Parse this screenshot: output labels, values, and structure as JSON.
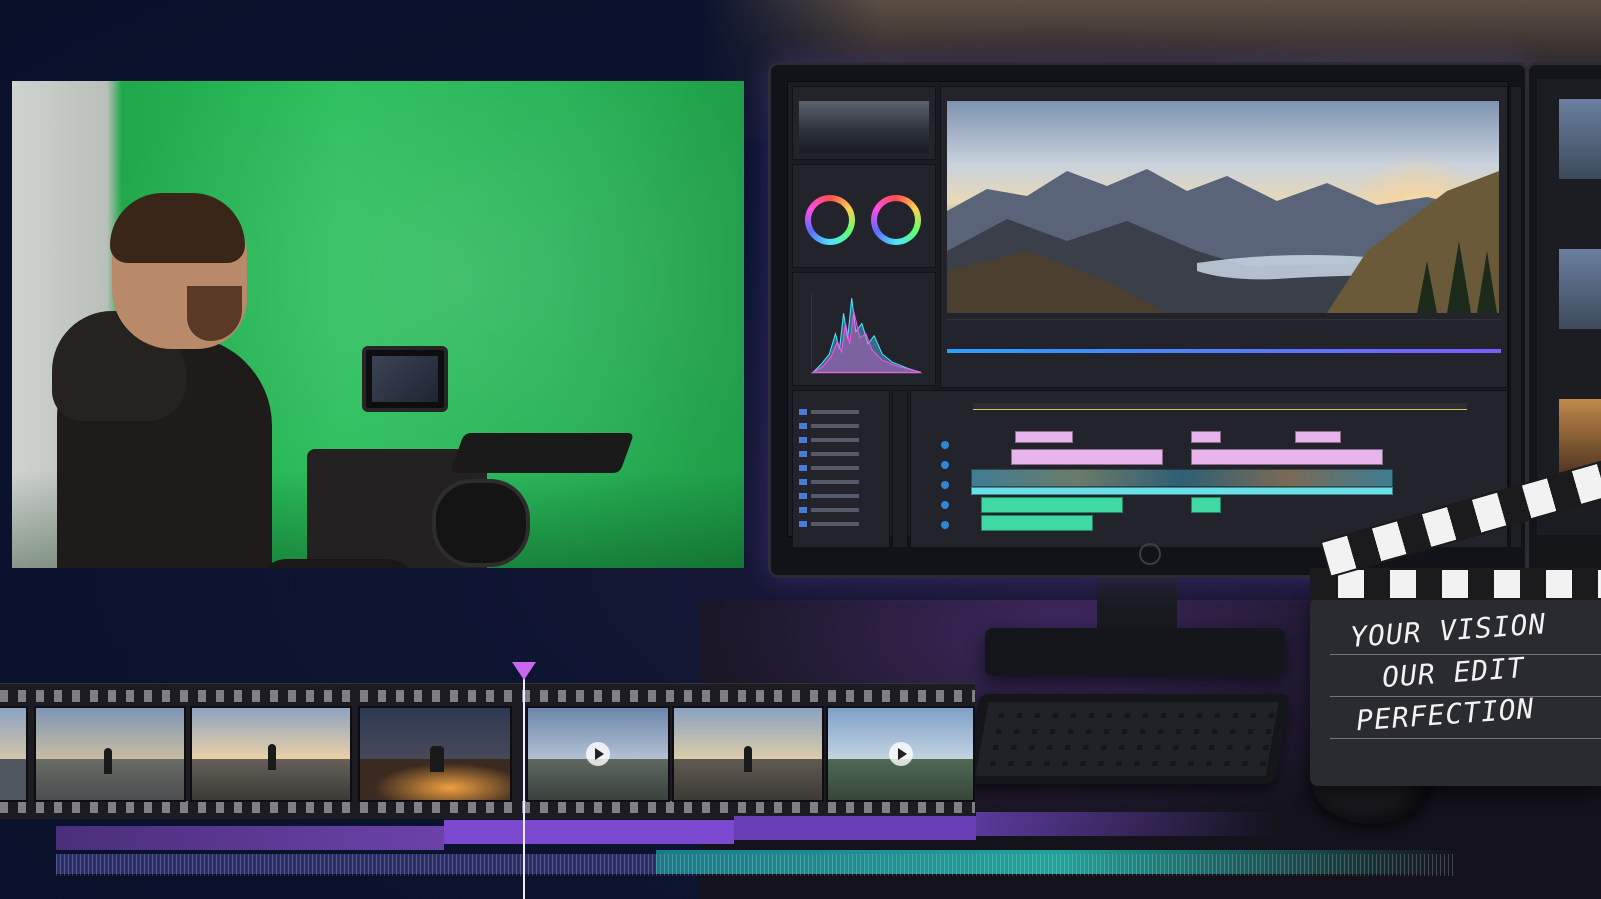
{
  "clapperboard": {
    "line1": "YOUR VISION",
    "line2": "OUR EDIT",
    "line3": "PERFECTION"
  },
  "editor": {
    "viewer_progress": 1.0
  },
  "colors": {
    "green_screen": "#2bbf5c",
    "accent_purple": "#a05cf0",
    "clip_pink": "#e7b4ec",
    "clip_cyan": "#69dfe8",
    "clip_teal": "#3fd9a4",
    "background": "#0c1430"
  },
  "icons": [
    "play-icon",
    "color-wheel-icon",
    "clapperboard-icon",
    "playhead-icon"
  ]
}
